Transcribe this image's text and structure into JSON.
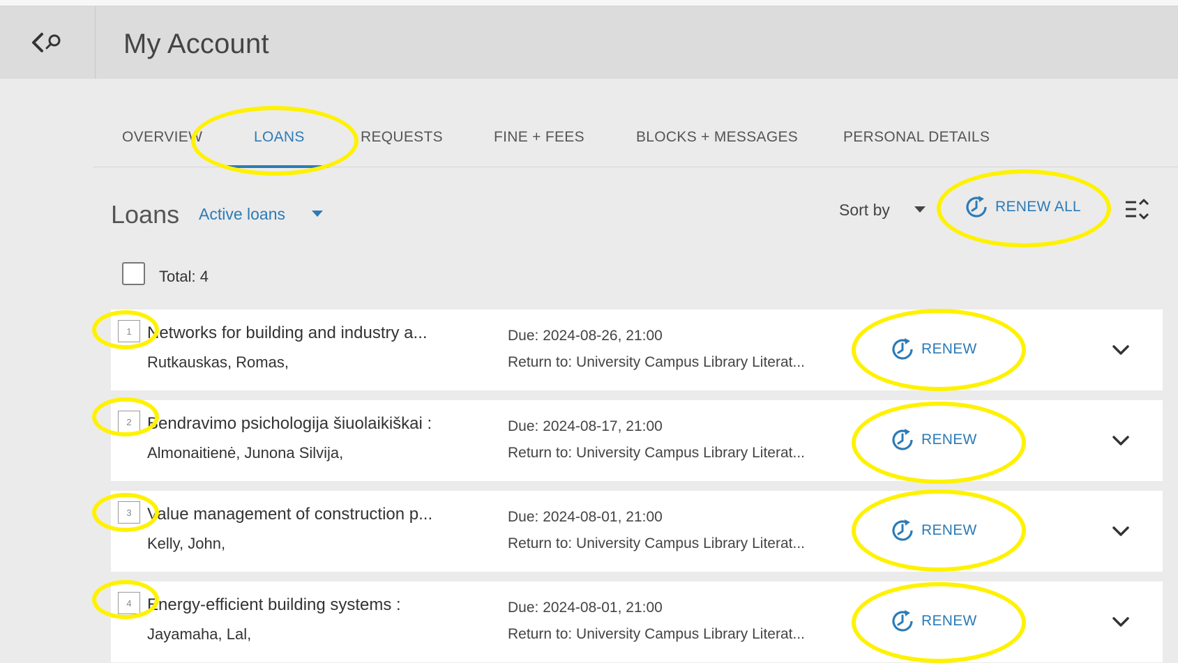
{
  "header": {
    "title": "My Account"
  },
  "tabs": [
    {
      "label": "OVERVIEW"
    },
    {
      "label": "LOANS"
    },
    {
      "label": "REQUESTS"
    },
    {
      "label": "FINE + FEES"
    },
    {
      "label": "BLOCKS + MESSAGES"
    },
    {
      "label": "PERSONAL DETAILS"
    }
  ],
  "active_tab": "LOANS",
  "loans_header": {
    "title": "Loans",
    "filter_label": "Active loans",
    "sort_label": "Sort by",
    "renew_all_label": "RENEW ALL"
  },
  "total_label": "Total: 4",
  "loans": [
    {
      "index": "1",
      "title": "Networks for building and industry a...",
      "author": "Rutkauskas, Romas,",
      "due": "Due: 2024-08-26, 21:00",
      "return_to": "Return to: University Campus Library Literat...",
      "renew_label": "RENEW"
    },
    {
      "index": "2",
      "title": "Bendravimo psichologija šiuolaikiškai :",
      "author": "Almonaitienė, Junona Silvija,",
      "due": "Due: 2024-08-17, 21:00",
      "return_to": "Return to: University Campus Library Literat...",
      "renew_label": "RENEW"
    },
    {
      "index": "3",
      "title": "Value management of construction p...",
      "author": "Kelly, John,",
      "due": "Due: 2024-08-01, 21:00",
      "return_to": "Return to: University Campus Library Literat...",
      "renew_label": "RENEW"
    },
    {
      "index": "4",
      "title": "Energy-efficient building systems :",
      "author": "Jayamaha, Lal,",
      "due": "Due: 2024-08-01, 21:00",
      "return_to": "Return to: University Campus Library Literat...",
      "renew_label": "RENEW"
    }
  ],
  "colors": {
    "accent": "#2c7bb6",
    "highlight": "#fff200",
    "background": "#ebebeb",
    "header": "#dcdcdc"
  },
  "icons": [
    "back-search-icon",
    "caret-down-icon",
    "renew-clock-icon",
    "list-toggle-icon",
    "chevron-down-icon"
  ]
}
